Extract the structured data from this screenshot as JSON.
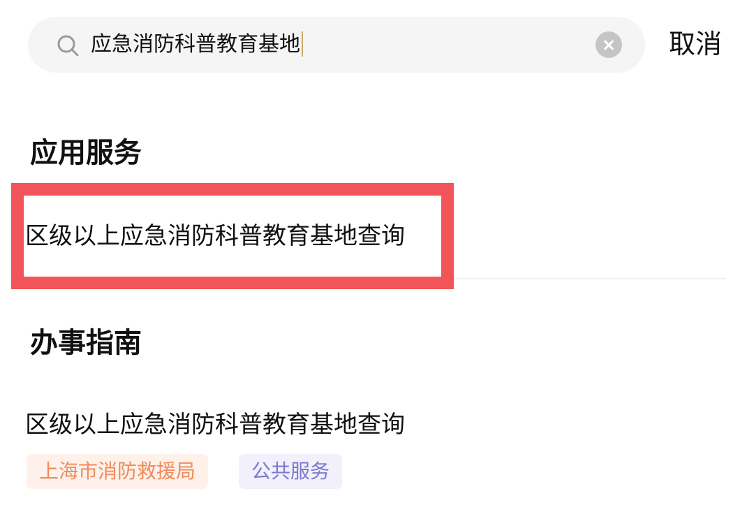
{
  "search": {
    "value": "应急消防科普教育基地",
    "cancel_label": "取消"
  },
  "sections": {
    "apps": {
      "title": "应用服务",
      "result": "区级以上应急消防科普教育基地查询"
    },
    "guides": {
      "title": "办事指南",
      "result": "区级以上应急消防科普教育基地查询",
      "tags": [
        "上海市消防救援局",
        "公共服务"
      ]
    }
  },
  "colors": {
    "highlight": "#f25559",
    "tag_org_text": "#f28a5a",
    "tag_type_text": "#7c78d0"
  },
  "icons": {
    "search": "search-icon",
    "clear": "clear-icon"
  }
}
